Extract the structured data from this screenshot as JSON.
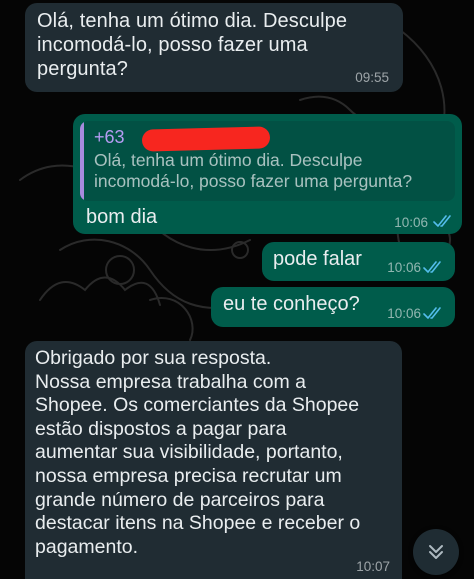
{
  "messages": [
    {
      "direction": "incoming",
      "text": "Olá, tenha um ótimo dia. Desculpe\nincomodá-lo, posso fazer uma\npergunta?",
      "time": "09:55"
    },
    {
      "direction": "outgoing",
      "quoted": {
        "author": "+63",
        "author_redacted": true,
        "text": "Olá, tenha um ótimo dia. Desculpe\nincomodá-lo, posso fazer uma pergunta?"
      },
      "text": "bom dia",
      "time": "10:06",
      "status": "read"
    },
    {
      "direction": "outgoing",
      "text": "pode falar",
      "time": "10:06",
      "status": "read"
    },
    {
      "direction": "outgoing",
      "text": "eu te conheço?",
      "time": "10:06",
      "status": "read"
    },
    {
      "direction": "incoming",
      "text": "Obrigado por sua resposta.\nNossa empresa trabalha com a\nShopee. Os comerciantes da Shopee\nestão dispostos a pagar para\naumentar sua visibilidade, portanto,\nnossa empresa precisa recrutar um\ngrande número de parceiros para\ndestacar itens na Shopee e receber o\npagamento.",
      "time": "10:07"
    }
  ],
  "icons": {
    "read_receipt": "double-check-icon",
    "scroll_down": "double-chevron-down-icon"
  },
  "colors": {
    "background": "#050505",
    "incoming_bubble": "#202c33",
    "outgoing_bubble": "#005c4b",
    "quote_background": "#025144",
    "quote_bar": "#a78bde",
    "read_ticks": "#53bdeb",
    "redaction": "#f7261f"
  }
}
